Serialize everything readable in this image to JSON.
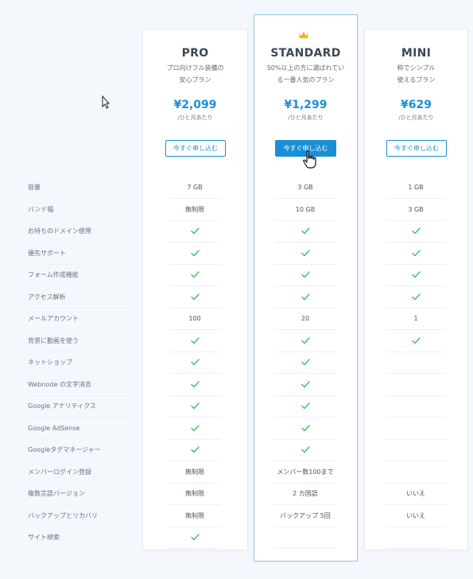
{
  "plans": [
    {
      "name": "PRO",
      "desc_line1": "プロ向けフル装備の",
      "desc_line2": "安心プラン",
      "price": "¥2,099",
      "per": "/ひと月あたり",
      "button": "今すぐ申し込む"
    },
    {
      "name": "STANDARD",
      "desc_line1": "50%以上の方に選ばれてい",
      "desc_line2": "る一番人気のプラン",
      "price": "¥1,299",
      "per": "/ひと月あたり",
      "button": "今すぐ申し込む"
    },
    {
      "name": "MINI",
      "desc_line1": "粋でシンプル",
      "desc_line2": "使えるプラン",
      "price": "¥629",
      "per": "/ひと月あたり",
      "button": "今すぐ申し込む"
    }
  ],
  "rows": [
    {
      "label": "容量",
      "pro": "7 GB",
      "standard": "3 GB",
      "mini": "1 GB"
    },
    {
      "label": "バンド幅",
      "pro": "無制限",
      "standard": "10 GB",
      "mini": "3 GB"
    },
    {
      "label": "お持ちのドメイン使用",
      "pro": "check",
      "standard": "check",
      "mini": "check"
    },
    {
      "label": "優先サポート",
      "pro": "check",
      "standard": "check",
      "mini": "check"
    },
    {
      "label": "フォーム作成機能",
      "pro": "check",
      "standard": "check",
      "mini": "check"
    },
    {
      "label": "アクセス解析",
      "pro": "check",
      "standard": "check",
      "mini": "check"
    },
    {
      "label": "メールアカウント",
      "pro": "100",
      "standard": "20",
      "mini": "1"
    },
    {
      "label": "背景に動画を使う",
      "pro": "check",
      "standard": "check",
      "mini": "check"
    },
    {
      "label": "ネットショップ",
      "pro": "check",
      "standard": "check",
      "mini": ""
    },
    {
      "label": "Webnode の文字消去",
      "pro": "check",
      "standard": "check",
      "mini": ""
    },
    {
      "label": "Google アナリティクス",
      "pro": "check",
      "standard": "check",
      "mini": ""
    },
    {
      "label": "Google AdSense",
      "pro": "check",
      "standard": "check",
      "mini": ""
    },
    {
      "label": "Googleタグマネージャー",
      "pro": "check",
      "standard": "check",
      "mini": ""
    },
    {
      "label": "メンバーログイン登録",
      "pro": "無制限",
      "standard": "メンバー数100まで",
      "mini": ""
    },
    {
      "label": "複数言語バージョン",
      "pro": "無制限",
      "standard": "2 カ国語",
      "mini": "いいえ"
    },
    {
      "label": "バックアップとリカバリ",
      "pro": "無制限",
      "standard": "バックアップ 5回",
      "mini": "いいえ"
    },
    {
      "label": "サイト検索",
      "pro": "check",
      "standard": "",
      "mini": ""
    }
  ],
  "colors": {
    "accent": "#1a8fd6",
    "check": "#3cc15a"
  },
  "icons": {
    "crown": "crown-icon",
    "check": "check-icon",
    "cursor": "hand-cursor-icon"
  }
}
